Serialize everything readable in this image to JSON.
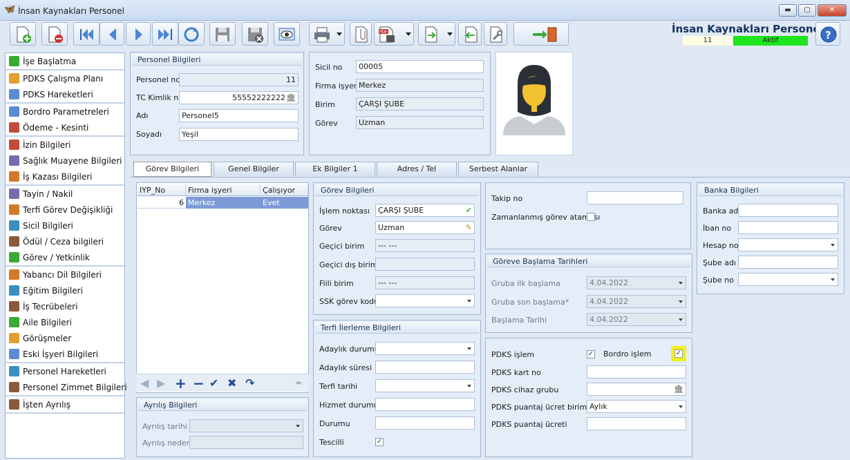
{
  "window": {
    "title": "İnsan Kaynakları Personel",
    "min": "▬",
    "max": "▢",
    "close": "✕"
  },
  "header": {
    "app_name": "İnsan Kaynakları Personel",
    "number": "11",
    "status": "Aktif"
  },
  "sidebar": {
    "groups": [
      [
        {
          "label": "İşe Başlatma",
          "icon": "flag-icon"
        }
      ],
      [
        {
          "label": "PDKS Çalışma Planı",
          "icon": "calendar-icon"
        },
        {
          "label": "PDKS Hareketleri",
          "icon": "timesheet-icon"
        }
      ],
      [
        {
          "label": "Bordro Parametreleri",
          "icon": "payroll-params-icon"
        },
        {
          "label": "Ödeme - Kesinti",
          "icon": "payment-icon"
        }
      ],
      [
        {
          "label": "İzin Bilgileri",
          "icon": "leave-icon"
        },
        {
          "label": "Sağlık Muayene Bilgileri",
          "icon": "health-icon"
        },
        {
          "label": "İş Kazası Bilgileri",
          "icon": "accident-icon"
        }
      ],
      [
        {
          "label": "Tayin / Nakil",
          "icon": "transfer-icon"
        },
        {
          "label": "Terfi Görev Değişikliği",
          "icon": "promotion-icon"
        },
        {
          "label": "Sicil Bilgileri",
          "icon": "record-icon"
        },
        {
          "label": "Ödül / Ceza bilgileri",
          "icon": "reward-icon"
        },
        {
          "label": "Görev / Yetkinlik",
          "icon": "competence-icon"
        }
      ],
      [
        {
          "label": "Yabancı Dil Bilgileri",
          "icon": "language-icon"
        },
        {
          "label": "Eğitim Bilgileri",
          "icon": "education-icon"
        },
        {
          "label": "İş Tecrübeleri",
          "icon": "experience-icon"
        },
        {
          "label": "Aile Bilgileri",
          "icon": "family-icon"
        },
        {
          "label": "Görüşmeler",
          "icon": "meetings-icon"
        },
        {
          "label": "Eski İşyeri Bilgileri",
          "icon": "info-icon"
        }
      ],
      [
        {
          "label": "Personel Hareketleri",
          "icon": "movements-icon"
        },
        {
          "label": "Personel Zimmet Bilgileri",
          "icon": "assets-icon"
        }
      ],
      [
        {
          "label": "İşten Ayrılış",
          "icon": "exit-icon"
        }
      ]
    ]
  },
  "personel": {
    "header": "Personel Bilgileri",
    "no_label": "Personel no",
    "no": "11",
    "tc_label": "TC Kimlik no",
    "tc": "55552222222",
    "ad_label": "Adı",
    "ad": "Personel5",
    "soyad_label": "Soyadı",
    "soyad": "Yeşil"
  },
  "sicil": {
    "sicil_label": "Sicil no",
    "sicil": "00005",
    "firma_label": "Firma işyeri",
    "firma": "Merkez",
    "birim_label": "Birim",
    "birim": "ÇARŞI ŞUBE",
    "gorev_label": "Görev",
    "gorev": "Uzman"
  },
  "tabs": [
    "Görev Bilgileri",
    "Genel Bilgiler",
    "Ek Bilgiler 1",
    "Adres / Tel",
    "Serbest Alanlar"
  ],
  "grid": {
    "headers": [
      "IYP_No",
      "Firma işyeri",
      "Çalışıyor"
    ],
    "row": [
      "6",
      "Merkez",
      "Evet"
    ]
  },
  "ayrilis": {
    "header": "Ayrılış Bilgileri",
    "tarih_label": "Ayrılış tarihi",
    "neden_label": "Ayrılış nedeni"
  },
  "gorev_bilgileri": {
    "header": "Görev Bilgileri",
    "islem_label": "İşlem noktası",
    "islem": "ÇARŞI ŞUBE",
    "gorev_label": "Görev",
    "gorev": "Uzman",
    "gecici_label": "Geçici birim",
    "gecici": "--- ---",
    "gecici_dis_label": "Geçici dış birim",
    "fiili_label": "Fiili birim",
    "fiili": "--- ---",
    "ssk_label": "SSK görev kodu"
  },
  "terfi": {
    "header": "Terfi İlerleme Bilgileri",
    "adaylik_durumu": "Adaylık durumu",
    "adaylik_suresi": "Adaylık süresi",
    "terfi_tarihi": "Terfi tarihi",
    "hizmet_durumu": "Hizmet durumu",
    "durumu": "Durumu",
    "tescilli": "Tescilli",
    "tescilli_value": true
  },
  "takip": {
    "takip_label": "Takip no",
    "zaman_label": "Zamanlanmış görev ataması"
  },
  "baslama": {
    "header": "Göreve Başlama Tarihleri",
    "grup_ilk_label": "Gruba ilk başlama",
    "grup_ilk": "4.04.2022",
    "grup_son_label": "Gruba son başlama*",
    "grup_son": "4.04.2022",
    "baslama_label": "Başlama Tarihi",
    "baslama": "4.04.2022"
  },
  "pdks": {
    "islem_label": "PDKS işlem",
    "islem_value": true,
    "bordro_label": "Bordro işlem",
    "bordro_value": true,
    "kart_label": "PDKS kart no",
    "cihaz_label": "PDKS cihaz grubu",
    "ucret_birimi_label": "PDKS puantaj ücret birimi",
    "ucret_birimi": "Aylık",
    "ucret_label": "PDKS puantaj ücreti"
  },
  "banka": {
    "header": "Banka Bilgileri",
    "adi": "Banka adı",
    "iban": "İban no",
    "hesap": "Hesap no",
    "sube_adi": "Şube adı",
    "sube_no": "Şube no"
  },
  "colors": {
    "accent": "#14325e",
    "status_green": "#1ee51e",
    "selected_row": "#7c9bd6",
    "highlight": "#f2f21a"
  }
}
